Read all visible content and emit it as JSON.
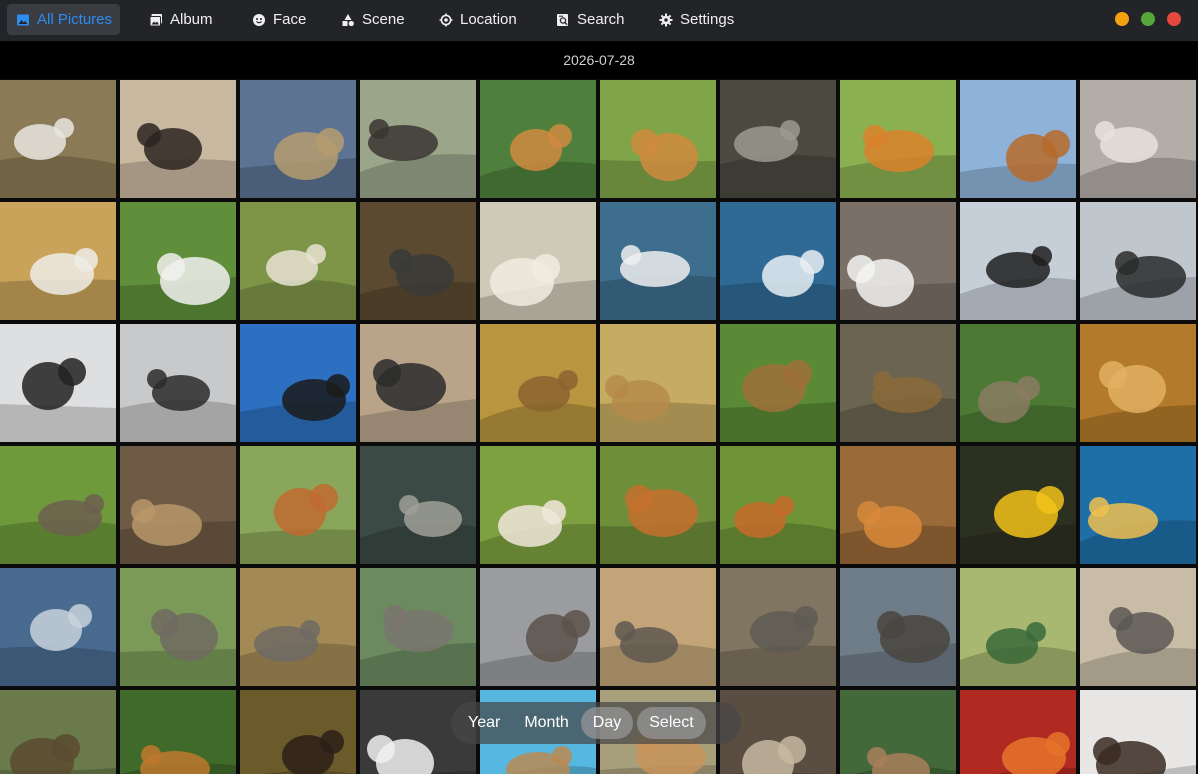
{
  "nav": {
    "items": [
      {
        "label": "All Pictures",
        "icon": "picture-icon",
        "active": true
      },
      {
        "label": "Album",
        "icon": "album-icon",
        "active": false
      },
      {
        "label": "Face",
        "icon": "face-icon",
        "active": false
      },
      {
        "label": "Scene",
        "icon": "scene-icon",
        "active": false
      },
      {
        "label": "Location",
        "icon": "location-icon",
        "active": false
      },
      {
        "label": "Search",
        "icon": "search-icon",
        "active": false
      },
      {
        "label": "Settings",
        "icon": "gear-icon",
        "active": false
      }
    ],
    "accent_color": "#2d8cf0"
  },
  "window_controls": [
    {
      "name": "minimize-button",
      "color": "#f2a20f"
    },
    {
      "name": "maximize-button",
      "color": "#55a63b"
    },
    {
      "name": "close-button",
      "color": "#e5483d"
    }
  ],
  "date_header": "2026-07-28",
  "view_toggle": {
    "options": [
      "Year",
      "Month",
      "Day"
    ],
    "selected": "Day",
    "select_label": "Select"
  },
  "thumbnails": [
    {
      "subject": "zebras running",
      "bg": "#8a7a55",
      "fg": "#e8e6e0"
    },
    {
      "subject": "zebra rolling in dust",
      "bg": "#c8b8a0",
      "fg": "#2b2520"
    },
    {
      "subject": "zebra herd savanna",
      "bg": "#5c7393",
      "fg": "#b59c6e"
    },
    {
      "subject": "zebra and foal on road",
      "bg": "#9aa58a",
      "fg": "#3a3530"
    },
    {
      "subject": "tiger lying",
      "bg": "#4f7f3c",
      "fg": "#d08a40"
    },
    {
      "subject": "squirrel on moss",
      "bg": "#7fa548",
      "fg": "#d08a3e"
    },
    {
      "subject": "grey squirrel at tree",
      "bg": "#4a4a40",
      "fg": "#9a9a92"
    },
    {
      "subject": "squirrel reflection",
      "bg": "#8ab050",
      "fg": "#d9822b"
    },
    {
      "subject": "squirrel on branch",
      "bg": "#8fb3d8",
      "fg": "#b86a2a"
    },
    {
      "subject": "grey squirrel standing",
      "bg": "#b3ada8",
      "fg": "#e6e2dc"
    },
    {
      "subject": "sheep on hillside",
      "bg": "#c9a35a",
      "fg": "#efece6"
    },
    {
      "subject": "sheep flock pasture",
      "bg": "#5f8f3a",
      "fg": "#f1f1ee"
    },
    {
      "subject": "sheep in field",
      "bg": "#7e9548",
      "fg": "#e8e2d2"
    },
    {
      "subject": "raccoon",
      "bg": "#5b4a30",
      "fg": "#3a3a38"
    },
    {
      "subject": "polar bears",
      "bg": "#cfc9b8",
      "fg": "#f1ecdf"
    },
    {
      "subject": "penguins on ice",
      "bg": "#3d6e8e",
      "fg": "#eeeeee"
    },
    {
      "subject": "penguins iceberg",
      "bg": "#2f6a94",
      "fg": "#e8eef3"
    },
    {
      "subject": "penguin colony rocks",
      "bg": "#7a7068",
      "fg": "#f3f3f3"
    },
    {
      "subject": "penguins on snow",
      "bg": "#c6cfd8",
      "fg": "#1e1e1e"
    },
    {
      "subject": "penguin on rock",
      "bg": "#bfc6cc",
      "fg": "#2a2a2a"
    },
    {
      "subject": "penguin crowd snow",
      "bg": "#dedfe0",
      "fg": "#222222"
    },
    {
      "subject": "penguins in fog",
      "bg": "#c8c9ca",
      "fg": "#2b2b2b"
    },
    {
      "subject": "penguins blue sky",
      "bg": "#2d6fc0",
      "fg": "#1b1b1b"
    },
    {
      "subject": "penguins on beach",
      "bg": "#b9a48a",
      "fg": "#2b2b2b"
    },
    {
      "subject": "lioness lying grass",
      "bg": "#b8953e",
      "fg": "#8a6430"
    },
    {
      "subject": "lioness sitting",
      "bg": "#c6ab62",
      "fg": "#b58b4a"
    },
    {
      "subject": "lion standing grass",
      "bg": "#5a8a35",
      "fg": "#a0703a"
    },
    {
      "subject": "lion lying",
      "bg": "#6b6450",
      "fg": "#8a6a3a"
    },
    {
      "subject": "hedgehog in grass",
      "bg": "#4c7a35",
      "fg": "#8a7b62"
    },
    {
      "subject": "lioness face",
      "bg": "#b27a2a",
      "fg": "#e0b060"
    },
    {
      "subject": "hedgehog walking",
      "bg": "#6e9a3b",
      "fg": "#6d5f50"
    },
    {
      "subject": "deer on rocky hill",
      "bg": "#6f5a45",
      "fg": "#b8966a"
    },
    {
      "subject": "fox in woods",
      "bg": "#8aa65a",
      "fg": "#c06a30"
    },
    {
      "subject": "goats on rocks",
      "bg": "#3b4a45",
      "fg": "#a0a098"
    },
    {
      "subject": "goat in grass",
      "bg": "#7da040",
      "fg": "#efe8da"
    },
    {
      "subject": "fox sitting",
      "bg": "#6e8e3a",
      "fg": "#c5702e"
    },
    {
      "subject": "fox walking",
      "bg": "#6f9438",
      "fg": "#c76b2a"
    },
    {
      "subject": "fox in leaves",
      "bg": "#9a6a38",
      "fg": "#d88a3a"
    },
    {
      "subject": "yellow fish",
      "bg": "#2c3020",
      "fg": "#f2c21a"
    },
    {
      "subject": "fish school reef",
      "bg": "#1e6fa8",
      "fg": "#f0c050"
    },
    {
      "subject": "fresh fish on ice",
      "bg": "#4a6b90",
      "fg": "#c8d2dc"
    },
    {
      "subject": "elephant walking",
      "bg": "#7b9a58",
      "fg": "#706a62"
    },
    {
      "subject": "elephants under trees",
      "bg": "#a38a55",
      "fg": "#6e6a64"
    },
    {
      "subject": "elephants at water",
      "bg": "#6c8a60",
      "fg": "#7a7570"
    },
    {
      "subject": "elephant on road",
      "bg": "#9a9ca0",
      "fg": "#5c524a"
    },
    {
      "subject": "elephant dust",
      "bg": "#c2a478",
      "fg": "#5e5850"
    },
    {
      "subject": "elephant herd river",
      "bg": "#807560",
      "fg": "#5e5a55"
    },
    {
      "subject": "elephant family",
      "bg": "#6e7c88",
      "fg": "#4a4540"
    },
    {
      "subject": "mallard duck",
      "bg": "#a8b870",
      "fg": "#3a6a3a"
    },
    {
      "subject": "elephant herd plain",
      "bg": "#c9bca6",
      "fg": "#5c5854"
    },
    {
      "subject": "ducks on pond",
      "bg": "#6a7a4a",
      "fg": "#5a4a30"
    },
    {
      "subject": "golden retriever",
      "bg": "#3f6a2a",
      "fg": "#c0782e"
    },
    {
      "subject": "german shepherd",
      "bg": "#6b5a2a",
      "fg": "#2c2018"
    },
    {
      "subject": "border collie",
      "bg": "#3a3a3a",
      "fg": "#f0f0f0"
    },
    {
      "subject": "deer at blue sky",
      "bg": "#56b8e0",
      "fg": "#b88a52"
    },
    {
      "subject": "fawn in grass",
      "bg": "#a8a07a",
      "fg": "#c8945a"
    },
    {
      "subject": "deer on hill",
      "bg": "#5a4e42",
      "fg": "#c8b8a2"
    },
    {
      "subject": "deer in plants",
      "bg": "#43683a",
      "fg": "#a8805a"
    },
    {
      "subject": "crab on red wall",
      "bg": "#b02a22",
      "fg": "#e8742a"
    },
    {
      "subject": "woman with dog",
      "bg": "#e8e6e4",
      "fg": "#3a2a22"
    }
  ]
}
